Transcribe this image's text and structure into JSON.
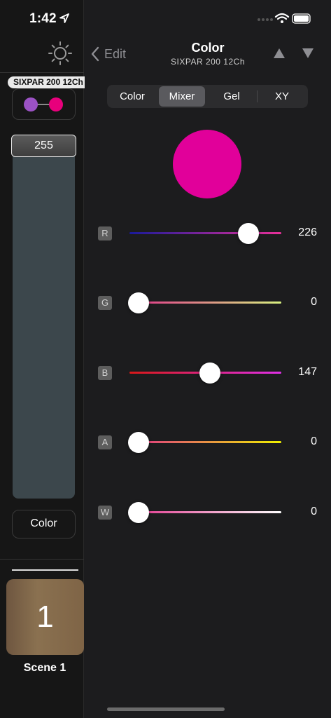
{
  "status": {
    "time": "1:42"
  },
  "sidebar": {
    "fixture_tag": "SIXPAR 200 12Ch",
    "dots": [
      {
        "color": "#9b52c4"
      },
      {
        "color": "#e8007c"
      }
    ],
    "intensity_value": "255",
    "color_button_label": "Color",
    "scene": {
      "number": "1",
      "label": "Scene 1"
    }
  },
  "nav": {
    "back_label": "Edit",
    "title": "Color",
    "subtitle": "SIXPAR 200 12Ch"
  },
  "tabs": [
    {
      "label": "Color",
      "selected": false
    },
    {
      "label": "Mixer",
      "selected": true
    },
    {
      "label": "Gel",
      "selected": false
    },
    {
      "label": "XY",
      "selected": false
    }
  ],
  "swatch_color": "#e1009a",
  "sliders": [
    {
      "channel": "R",
      "value": "226",
      "level": 226,
      "max": 255
    },
    {
      "channel": "G",
      "value": "0",
      "level": 0,
      "max": 255
    },
    {
      "channel": "B",
      "value": "147",
      "level": 147,
      "max": 255
    },
    {
      "channel": "A",
      "value": "0",
      "level": 0,
      "max": 255
    },
    {
      "channel": "W",
      "value": "0",
      "level": 0,
      "max": 255
    }
  ]
}
